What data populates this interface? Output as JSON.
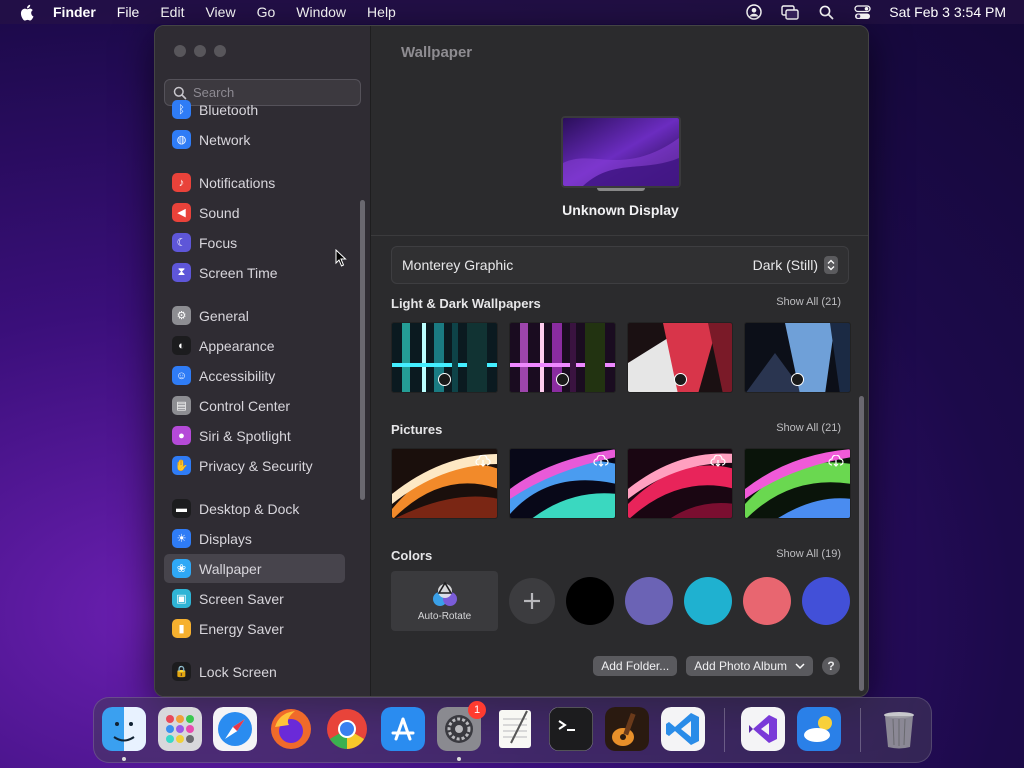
{
  "menubar": {
    "app_name": "Finder",
    "menus": [
      "File",
      "Edit",
      "View",
      "Go",
      "Window",
      "Help"
    ],
    "clock": "Sat Feb 3  3:54 PM",
    "icons": [
      "apple-icon",
      "user-icon",
      "screen-mirroring-icon",
      "search-icon",
      "control-center-icon"
    ]
  },
  "sidebar": {
    "search_placeholder": "Search",
    "items": [
      {
        "label": "Bluetooth",
        "icon": "bluetooth-icon",
        "color": "#2f7cf6"
      },
      {
        "label": "Network",
        "icon": "globe-icon",
        "color": "#2f7cf6"
      },
      {
        "label": "Notifications",
        "icon": "bell-icon",
        "color": "#e9423a"
      },
      {
        "label": "Sound",
        "icon": "speaker-icon",
        "color": "#e9423a"
      },
      {
        "label": "Focus",
        "icon": "moon-icon",
        "color": "#5e56d8"
      },
      {
        "label": "Screen Time",
        "icon": "hourglass-icon",
        "color": "#5e56d8"
      },
      {
        "label": "General",
        "icon": "gear-icon",
        "color": "#8d8d92"
      },
      {
        "label": "Appearance",
        "icon": "appearance-icon",
        "color": "#1c1c1e"
      },
      {
        "label": "Accessibility",
        "icon": "accessibility-icon",
        "color": "#2f7cf6"
      },
      {
        "label": "Control Center",
        "icon": "control-center-icon",
        "color": "#8d8d92"
      },
      {
        "label": "Siri & Spotlight",
        "icon": "siri-icon",
        "color": "#b54ad8"
      },
      {
        "label": "Privacy & Security",
        "icon": "hand-icon",
        "color": "#2f7cf6"
      },
      {
        "label": "Desktop & Dock",
        "icon": "dock-icon",
        "color": "#1c1c1e"
      },
      {
        "label": "Displays",
        "icon": "sun-icon",
        "color": "#2f7cf6"
      },
      {
        "label": "Wallpaper",
        "icon": "wallpaper-icon",
        "color": "#2fa8f6"
      },
      {
        "label": "Screen Saver",
        "icon": "screensaver-icon",
        "color": "#2fb4d6"
      },
      {
        "label": "Energy Saver",
        "icon": "battery-icon",
        "color": "#f6b02f"
      },
      {
        "label": "Lock Screen",
        "icon": "lock-icon",
        "color": "#1c1c1e"
      }
    ],
    "active": "Wallpaper"
  },
  "content": {
    "title": "Wallpaper",
    "display_name": "Unknown Display",
    "wallpaper_name": "Monterey Graphic",
    "wallpaper_mode": "Dark (Still)",
    "sections": {
      "light_dark": {
        "title": "Light & Dark Wallpapers",
        "show_all": "Show All (21)"
      },
      "pictures": {
        "title": "Pictures",
        "show_all": "Show All (21)"
      },
      "colors": {
        "title": "Colors",
        "show_all": "Show All (19)"
      }
    },
    "auto_rotate_label": "Auto-Rotate",
    "color_swatches": [
      "#000000",
      "#6b63b5",
      "#1fb1d0",
      "#e86670",
      "#4250d8"
    ],
    "buttons": {
      "add_folder": "Add Folder...",
      "add_photo_album": "Add Photo Album",
      "help": "?"
    }
  },
  "dock": {
    "apps": [
      {
        "name": "Finder",
        "icon": "finder-icon"
      },
      {
        "name": "Launchpad",
        "icon": "launchpad-icon"
      },
      {
        "name": "Safari",
        "icon": "safari-icon"
      },
      {
        "name": "Firefox",
        "icon": "firefox-icon"
      },
      {
        "name": "Chrome",
        "icon": "chrome-icon"
      },
      {
        "name": "App Store",
        "icon": "app-store-icon"
      },
      {
        "name": "System Settings",
        "icon": "settings-icon",
        "badge": "1"
      },
      {
        "name": "TextEdit",
        "icon": "textedit-icon"
      },
      {
        "name": "Terminal",
        "icon": "terminal-icon"
      },
      {
        "name": "GarageBand",
        "icon": "garageband-icon"
      },
      {
        "name": "VS Code",
        "icon": "vscode-icon"
      },
      {
        "name": "Visual Studio",
        "icon": "visual-studio-icon"
      },
      {
        "name": "Weather",
        "icon": "weather-icon"
      },
      {
        "name": "Trash",
        "icon": "trash-icon"
      }
    ]
  }
}
